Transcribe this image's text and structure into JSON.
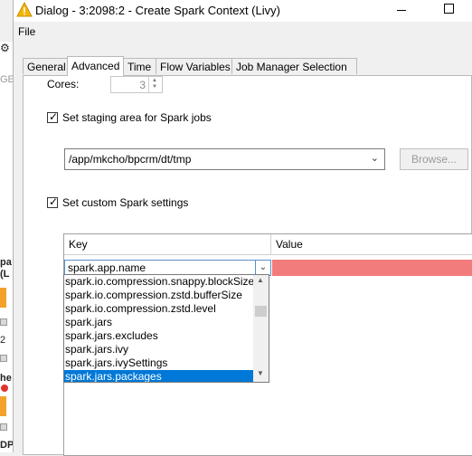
{
  "window": {
    "title": "Dialog - 3:2098:2 - Create Spark Context (Livy)"
  },
  "menu": {
    "file": "File"
  },
  "tabs": [
    {
      "label": "General"
    },
    {
      "label": "Advanced"
    },
    {
      "label": "Time"
    },
    {
      "label": "Flow Variables"
    },
    {
      "label": "Job Manager Selection"
    }
  ],
  "advanced": {
    "cores_label": "Cores:",
    "cores_value": "3",
    "staging_checkbox_label": "Set staging area for Spark jobs",
    "staging_checked": true,
    "staging_path": "/app/mkcho/bpcrm/dt/tmp",
    "browse_label": "Browse...",
    "custom_checkbox_label": "Set custom Spark settings",
    "custom_checked": true
  },
  "table": {
    "columns": [
      "Key",
      "Value"
    ],
    "rows": [
      {
        "key": "spark.app.name",
        "value": ""
      }
    ]
  },
  "dropdown": {
    "options": [
      "spark.io.compression.snappy.blockSize",
      "spark.io.compression.zstd.bufferSize",
      "spark.io.compression.zstd.level",
      "spark.jars",
      "spark.jars.excludes",
      "spark.jars.ivy",
      "spark.jars.ivySettings",
      "spark.jars.packages"
    ],
    "selected": "spark.jars.packages"
  },
  "background": {
    "fragments": [
      "pa",
      "(L",
      "GE",
      "2",
      "he",
      "DP"
    ]
  },
  "colors": {
    "accent": "#0078d7",
    "invalid_cell": "#f27b7b",
    "warning_icon": "#f5b400"
  }
}
